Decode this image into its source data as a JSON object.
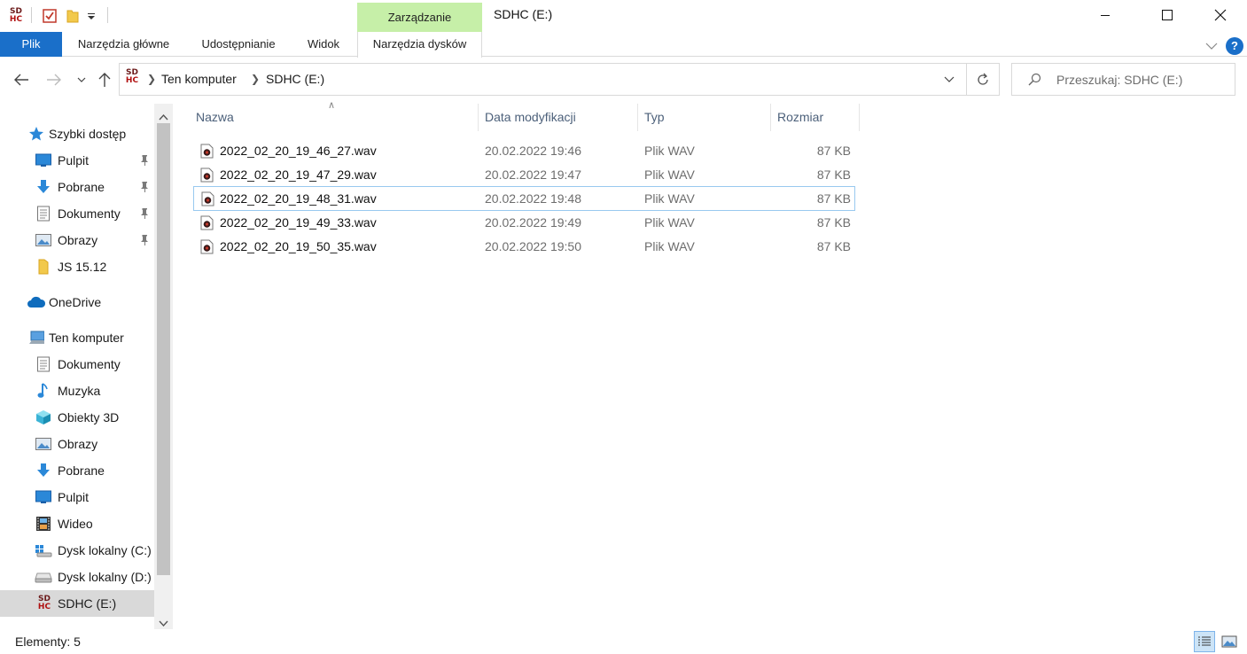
{
  "window": {
    "title": "SDHC (E:)",
    "context_tab": "Zarządzanie"
  },
  "drive_logo": {
    "top": "SD",
    "bottom": "HC"
  },
  "ribbon": {
    "tabs": [
      "Plik",
      "Narzędzia główne",
      "Udostępnianie",
      "Widok",
      "Narzędzia dysków"
    ],
    "help": "?"
  },
  "address": {
    "crumbs": [
      "Ten komputer",
      "SDHC (E:)"
    ]
  },
  "search": {
    "placeholder": "Przeszukaj: SDHC (E:)"
  },
  "sidebar": {
    "quick_access": {
      "label": "Szybki dostęp",
      "icon": "star-icon"
    },
    "quick_items": [
      {
        "label": "Pulpit",
        "icon": "desktop-icon",
        "pinned": true
      },
      {
        "label": "Pobrane",
        "icon": "download-icon",
        "pinned": true
      },
      {
        "label": "Dokumenty",
        "icon": "documents-icon",
        "pinned": true
      },
      {
        "label": "Obrazy",
        "icon": "pictures-icon",
        "pinned": true
      },
      {
        "label": "JS 15.12",
        "icon": "folder-icon",
        "pinned": false
      }
    ],
    "onedrive": {
      "label": "OneDrive",
      "icon": "cloud-icon"
    },
    "this_pc": {
      "label": "Ten komputer",
      "icon": "computer-icon"
    },
    "pc_items": [
      {
        "label": "Dokumenty",
        "icon": "documents-icon"
      },
      {
        "label": "Muzyka",
        "icon": "music-icon"
      },
      {
        "label": "Obiekty 3D",
        "icon": "cube-icon"
      },
      {
        "label": "Obrazy",
        "icon": "pictures-icon"
      },
      {
        "label": "Pobrane",
        "icon": "download-icon"
      },
      {
        "label": "Pulpit",
        "icon": "desktop-icon"
      },
      {
        "label": "Wideo",
        "icon": "video-icon"
      },
      {
        "label": "Dysk lokalny (C:)",
        "icon": "windows-drive-icon"
      },
      {
        "label": "Dysk lokalny (D:)",
        "icon": "drive-icon"
      },
      {
        "label": "SDHC (E:)",
        "icon": "sdhc-icon",
        "selected": true
      }
    ]
  },
  "columns": {
    "name": "Nazwa",
    "date": "Data modyfikacji",
    "type": "Typ",
    "size": "Rozmiar"
  },
  "files": [
    {
      "name": "2022_02_20_19_46_27.wav",
      "date": "20.02.2022 19:46",
      "type": "Plik WAV",
      "size": "87 KB"
    },
    {
      "name": "2022_02_20_19_47_29.wav",
      "date": "20.02.2022 19:47",
      "type": "Plik WAV",
      "size": "87 KB"
    },
    {
      "name": "2022_02_20_19_48_31.wav",
      "date": "20.02.2022 19:48",
      "type": "Plik WAV",
      "size": "87 KB",
      "focused": true
    },
    {
      "name": "2022_02_20_19_49_33.wav",
      "date": "20.02.2022 19:49",
      "type": "Plik WAV",
      "size": "87 KB"
    },
    {
      "name": "2022_02_20_19_50_35.wav",
      "date": "20.02.2022 19:50",
      "type": "Plik WAV",
      "size": "87 KB"
    }
  ],
  "status": {
    "items": "Elementy: 5"
  },
  "colors": {
    "accent": "#1a6fc9",
    "context_tab": "#c6efa8",
    "selected": "#d9d9d9",
    "focus_border": "#99c9ef"
  }
}
